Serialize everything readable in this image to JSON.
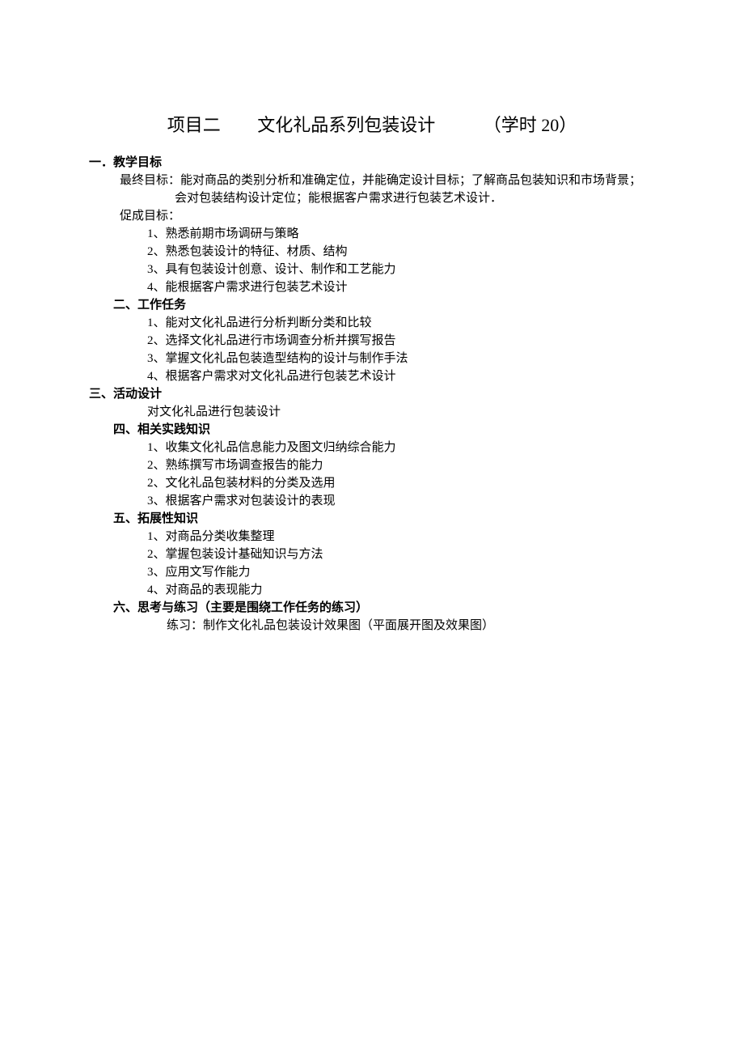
{
  "title": {
    "project_label": "项目二",
    "project_name": "文化礼品系列包装设计",
    "hours_prefix": "（学时 ",
    "hours_number": "20",
    "hours_suffix": "）"
  },
  "s1": {
    "head": "一．教学目标",
    "final_goal_label": "最终目标：",
    "final_goal_line1": "能对商品的类别分析和准确定位，并能确定设计目标；了解商品包装知识和市场背景；",
    "final_goal_line2": "会对包装结构设计定位；能根据客户需求进行包装艺术设计．",
    "sub_goal_label": "促成目标：",
    "items": [
      "1、熟悉前期市场调研与策略",
      "2、熟悉包装设计的特征、材质、结构",
      "3、具有包装设计创意、设计、制作和工艺能力",
      "4、能根据客户需求进行包装艺术设计"
    ]
  },
  "s2": {
    "head": "二、工作任务",
    "items": [
      "1、能对文化礼品进行分析判断分类和比较",
      "2、选择文化礼品进行市场调查分析并撰写报告",
      "3、掌握文化礼品包装造型结构的设计与制作手法",
      "4、根据客户需求对文化礼品进行包装艺术设计"
    ]
  },
  "s3": {
    "head": "三、活动设计",
    "body": "对文化礼品进行包装设计"
  },
  "s4": {
    "head": "四、相关实践知识",
    "items": [
      "1、收集文化礼品信息能力及图文归纳综合能力",
      "2、熟练撰写市场调查报告的能力",
      "2、文化礼品包装材料的分类及选用",
      "3、根据客户需求对包装设计的表现"
    ]
  },
  "s5": {
    "head": "五、拓展性知识",
    "items": [
      "1、对商品分类收集整理",
      "2、掌握包装设计基础知识与方法",
      "3、应用文写作能力",
      "4、对商品的表现能力"
    ]
  },
  "s6": {
    "head": "六、思考与练习（主要是围绕工作任务的练习）",
    "body": "练习：制作文化礼品包装设计效果图（平面展开图及效果图）"
  }
}
